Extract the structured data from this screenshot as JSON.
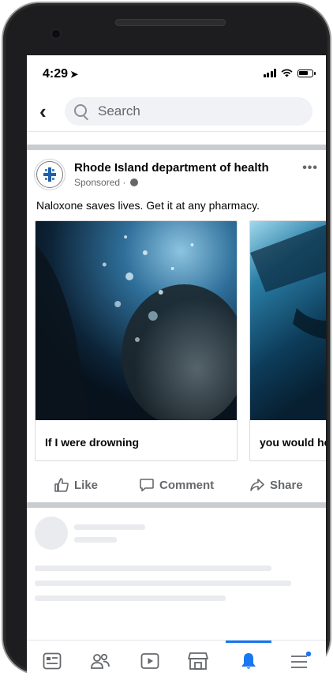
{
  "status": {
    "time": "4:29"
  },
  "search": {
    "placeholder": "Search"
  },
  "post": {
    "author": "Rhode Island department of health",
    "sponsored_label": "Sponsored · ",
    "caption": "Naloxone saves lives. Get it at any pharmacy.",
    "cards": [
      {
        "caption": "If I were drowning"
      },
      {
        "caption": "you would help"
      }
    ],
    "actions": {
      "like": "Like",
      "comment": "Comment",
      "share": "Share"
    }
  },
  "colors": {
    "accent": "#1877f2",
    "text_secondary": "#65676b"
  },
  "tabbar": {
    "items": [
      {
        "icon": "news-feed-icon"
      },
      {
        "icon": "friends-icon"
      },
      {
        "icon": "watch-icon"
      },
      {
        "icon": "marketplace-icon"
      },
      {
        "icon": "notifications-bell-icon",
        "active": true
      },
      {
        "icon": "menu-icon"
      }
    ]
  }
}
